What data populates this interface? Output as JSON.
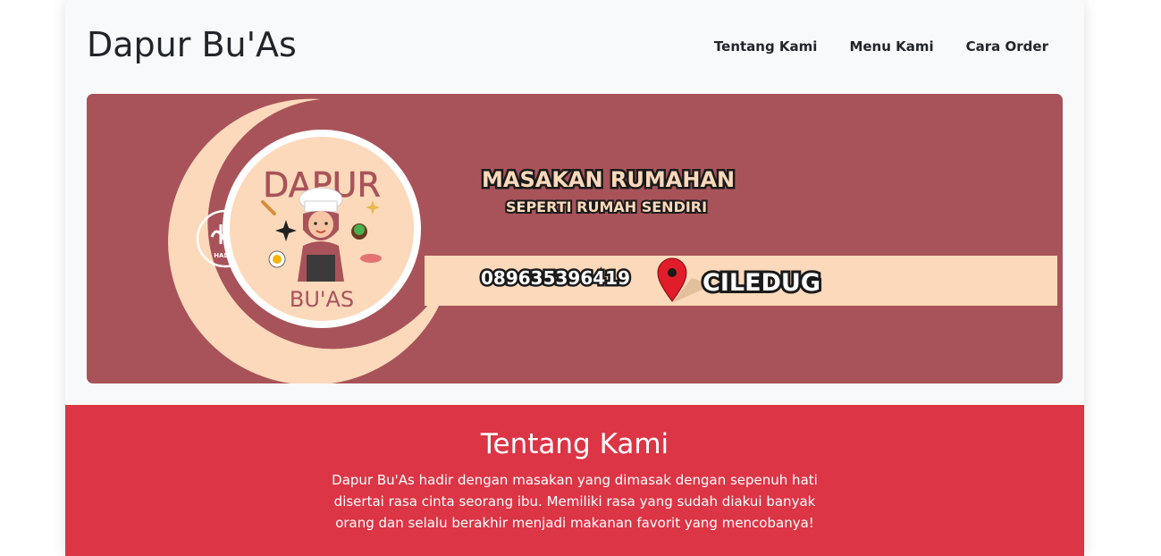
{
  "navbar": {
    "brand": "Dapur Bu'As",
    "links": [
      {
        "label": "Tentang Kami"
      },
      {
        "label": "Menu Kami"
      },
      {
        "label": "Cara Order"
      }
    ]
  },
  "banner": {
    "logo_top_text": "DAPUR",
    "logo_bottom_text": "BU'AS",
    "halal_label": "HALAL",
    "headline": "MASAKAN RUMAHAN",
    "subheadline": "SEPERTI RUMAH SENDIRI",
    "phone": "089635396419",
    "location": "CILEDUG",
    "colors": {
      "background": "#a8535a",
      "cream": "#fdd9bb",
      "pin": "#e11d2a"
    }
  },
  "about": {
    "title": "Tentang Kami",
    "text": "Dapur Bu'As hadir dengan masakan yang dimasak dengan sepenuh hati disertai rasa cinta seorang ibu. Memiliki rasa yang sudah diakui banyak orang dan selalu berakhir menjadi makanan favorit yang mencobanya!",
    "background": "#dc3545"
  }
}
